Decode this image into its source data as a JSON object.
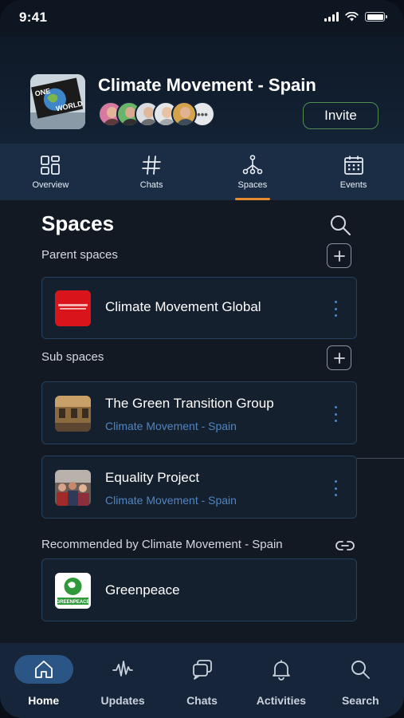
{
  "status_bar": {
    "time": "9:41"
  },
  "header": {
    "space_name": "Climate Movement - Spain",
    "avatar_text_top": "ONE",
    "avatar_text_bottom": "WORLD",
    "member_overflow": "•••",
    "invite_label": "Invite"
  },
  "tabs": [
    {
      "label": "Overview",
      "icon": "overview-icon"
    },
    {
      "label": "Chats",
      "icon": "hash-icon"
    },
    {
      "label": "Spaces",
      "icon": "spaces-icon",
      "active": true
    },
    {
      "label": "Events",
      "icon": "calendar-icon"
    }
  ],
  "spaces": {
    "heading": "Spaces",
    "parent_label": "Parent spaces",
    "sub_label": "Sub spaces",
    "recommended_label": "Recommended by Climate Movement - Spain",
    "parent": [
      {
        "title": "Climate Movement Global"
      }
    ],
    "sub": [
      {
        "title": "The Green Transition Group",
        "subtitle": "Climate Movement - Spain"
      },
      {
        "title": "Equality Project",
        "subtitle": "Climate Movement - Spain"
      }
    ],
    "recommended": [
      {
        "title": "Greenpeace",
        "logo_text": "GREENPEACE"
      }
    ]
  },
  "bottom_nav": [
    {
      "label": "Home",
      "icon": "home-icon",
      "active": true
    },
    {
      "label": "Updates",
      "icon": "updates-icon"
    },
    {
      "label": "Chats",
      "icon": "chats-icon"
    },
    {
      "label": "Activities",
      "icon": "bell-icon"
    },
    {
      "label": "Search",
      "icon": "search-icon"
    }
  ],
  "colors": {
    "accent_tab": "#e58a2d",
    "invite_border": "#4f8f52",
    "nav_active_pill": "#2a5585",
    "subtitle_blue": "#4f85c2"
  }
}
